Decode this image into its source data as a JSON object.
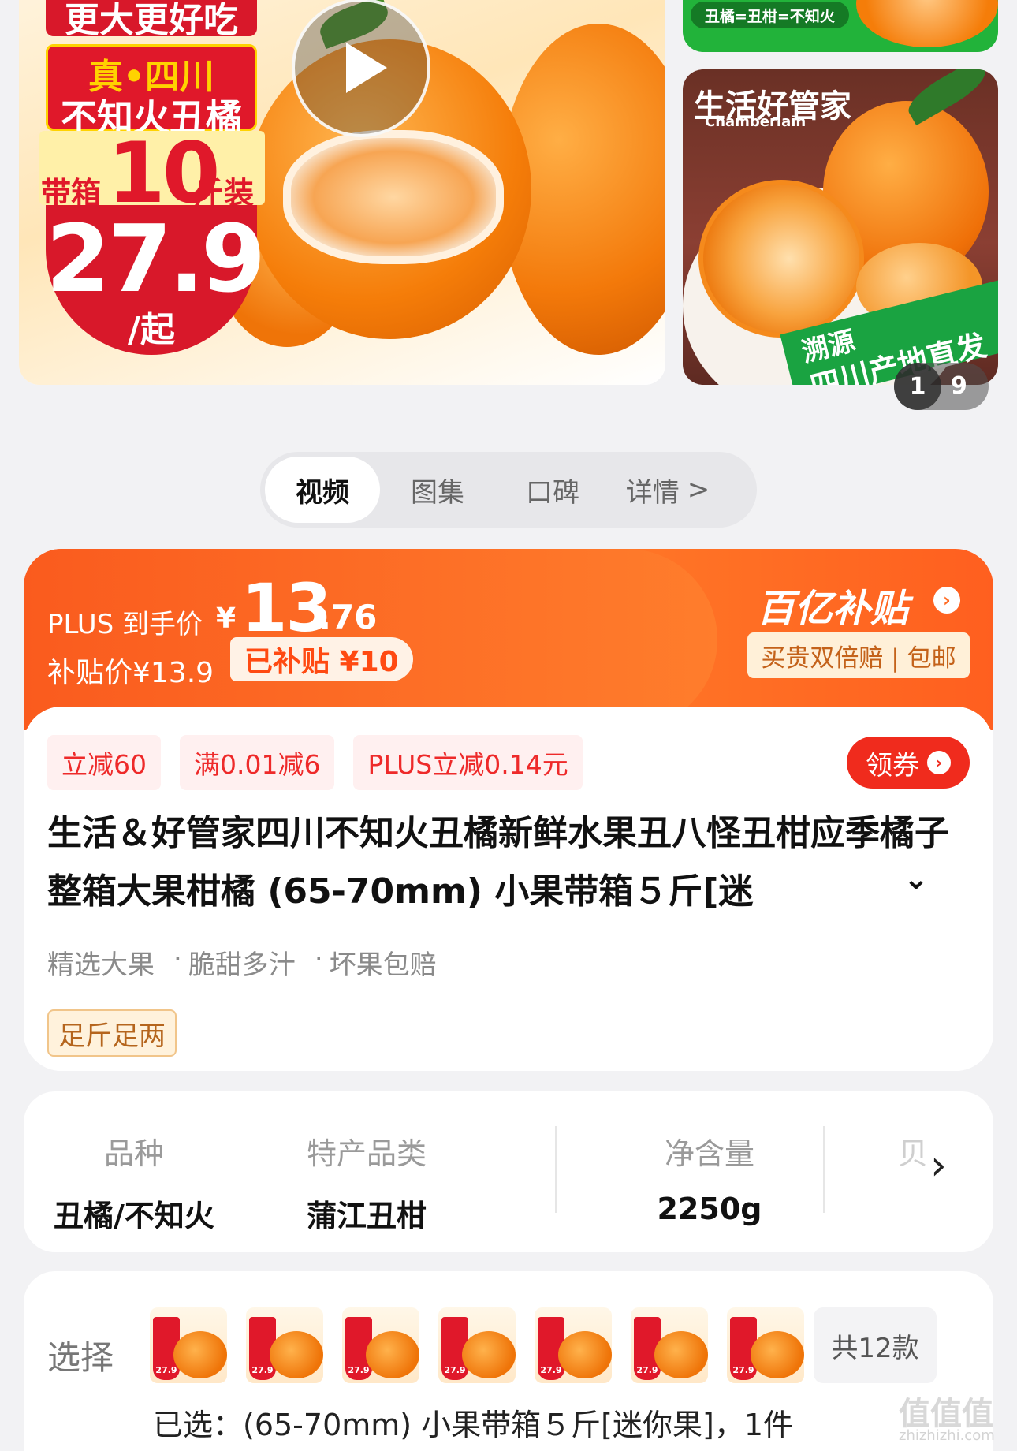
{
  "media": {
    "promo_top": "更大更好吃",
    "promo_line1": "真•四川",
    "promo_line2": "不知火丑橘",
    "box_prefix": "带箱",
    "box_weight": "10",
    "box_suffix": "斤装",
    "badge_price": "27.9",
    "badge_unit": "/起",
    "play_icon": "play-icon"
  },
  "side": {
    "top_pill": "丑橘=丑柑=不知火",
    "brand_cn": "生活好管家",
    "brand_en": "Chamberlain",
    "ribbon_line1": "溯源",
    "ribbon_line2": "四川产地直发",
    "counter_current": "1",
    "counter_total": "9"
  },
  "tabs": [
    {
      "label": "视频"
    },
    {
      "label": "图集"
    },
    {
      "label": "口碑"
    },
    {
      "label": "详情",
      "chevron": ">"
    }
  ],
  "price": {
    "plus_label": "PLUS 到手价",
    "currency": "¥",
    "plus_int": "13",
    "plus_dec": ".76",
    "subsidy_label": "补贴价¥13.9",
    "subsidy_badge": "已补贴 ¥10",
    "program_logo": "百亿补贴",
    "program_arrow": "›",
    "program_tag": "买贵双倍赔 | 包邮"
  },
  "promos": {
    "chips": [
      "立减60",
      "满0.01减6",
      "PLUS立减0.14元"
    ],
    "coupon_label": "领券",
    "coupon_arrow": "›"
  },
  "product": {
    "title": "生活＆好管家四川不知火丑橘新鲜水果丑八怪丑柑应季橘子整箱大果柑橘 (65-70mm) 小果带箱５斤[迷",
    "title_expand": "⌄",
    "features": [
      "精选大果",
      "脆甜多汁",
      "坏果包赔"
    ],
    "feature_sep": "·",
    "tag": "足斤足两"
  },
  "specs": [
    {
      "key": "品种",
      "value": "丑橘/不知火"
    },
    {
      "key": "特产品类",
      "value": "蒲江丑柑"
    },
    {
      "key": "净含量",
      "value": "2250g"
    },
    {
      "key": "贝",
      "value": ""
    }
  ],
  "spec_more": "›",
  "variants": {
    "label": "选择",
    "thumb_price": "27.9",
    "thumb_count": 7,
    "count_label": "共12款",
    "selected": "已选：(65-70mm) 小果带箱５斤[迷你果]，1件"
  },
  "watermark": {
    "text": "值值值",
    "sub": "zhizhizhi.com"
  },
  "colors": {
    "accent": "#ff6a22",
    "red": "#e0182a",
    "coupon": "#f02b1d",
    "green": "#1aa341"
  }
}
